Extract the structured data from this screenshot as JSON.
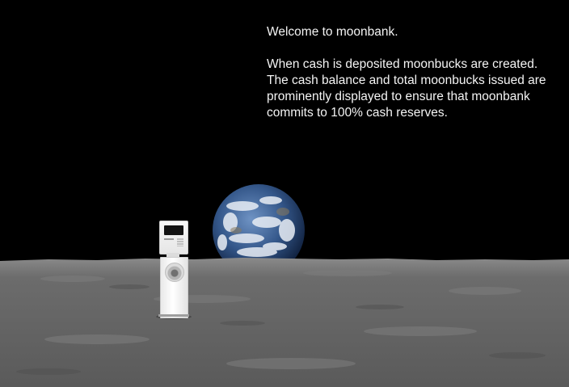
{
  "welcome": {
    "title": "Welcome to moonbank.",
    "line1": "When cash is deposited moonbucks are created.",
    "line2": "The cash balance and total moonbucks issued are",
    "line3": "prominently displayed to ensure that moonbank",
    "line4": "commits to 100% cash reserves."
  },
  "colors": {
    "sky": "#000000",
    "text": "#f4f4f4",
    "ocean": "#3b5f8f",
    "lunar_surface": "#6e6e6e"
  },
  "icons": {
    "atm": "atm-machine-icon",
    "earth": "earth-icon"
  }
}
